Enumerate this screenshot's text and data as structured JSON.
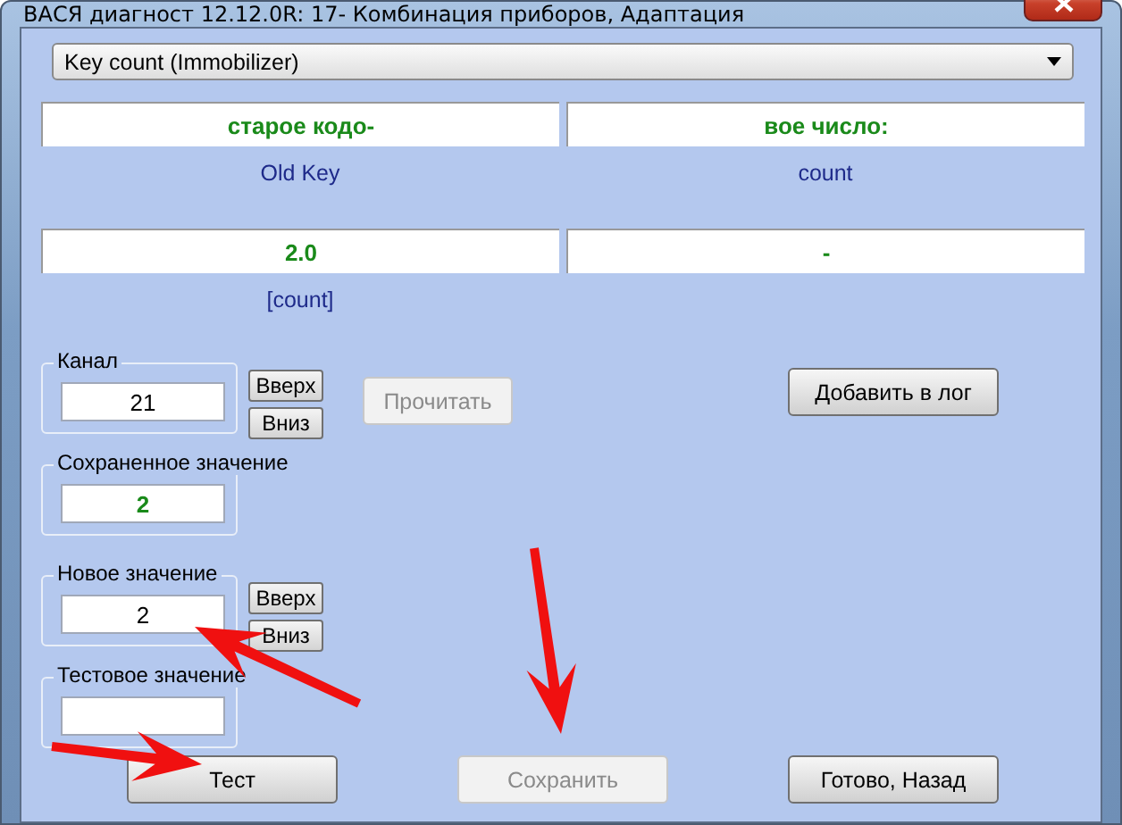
{
  "window": {
    "title": "ВАСЯ диагност 12.12.0R: 17- Комбинация приборов, Адаптация"
  },
  "parameter_select": {
    "value": "Key count (Immobilizer)"
  },
  "info_rows": [
    {
      "cells": [
        "старое кодо-",
        "вое число:"
      ],
      "captions": [
        "Old Key",
        "count"
      ]
    },
    {
      "cells": [
        "2.0",
        "-"
      ],
      "captions": [
        "[count]"
      ]
    }
  ],
  "channel": {
    "label": "Канал",
    "value": "21",
    "up": "Вверх",
    "down": "Вниз"
  },
  "read_button": {
    "label": "Прочитать",
    "disabled": true
  },
  "log_button": {
    "label": "Добавить в лог",
    "disabled": false
  },
  "saved": {
    "label": "Сохраненное значение",
    "value": "2"
  },
  "new_value": {
    "label": "Новое значение",
    "value": "2",
    "up": "Вверх",
    "down": "Вниз"
  },
  "test_value": {
    "label": "Тестовое значение"
  },
  "buttons": [
    {
      "label": "Тест",
      "disabled": false
    },
    {
      "label": "Сохранить",
      "disabled": true
    },
    {
      "label": "Готово, Назад",
      "disabled": false
    }
  ]
}
